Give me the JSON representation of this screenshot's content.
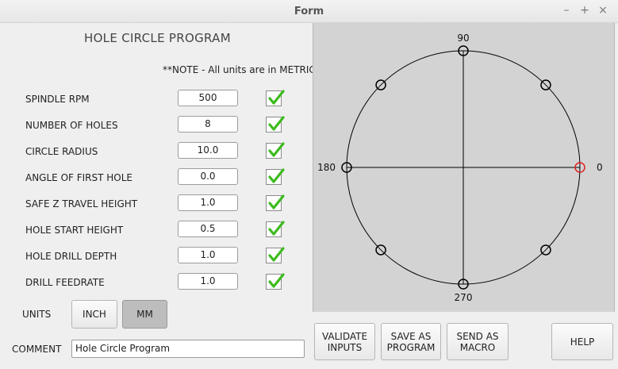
{
  "window": {
    "title": "Form",
    "controls": [
      "–",
      "+",
      "×"
    ]
  },
  "heading": "HOLE CIRCLE PROGRAM",
  "note": "**NOTE - All units are in METRIC",
  "fields": [
    {
      "label": "SPINDLE RPM",
      "value": "500"
    },
    {
      "label": "NUMBER OF HOLES",
      "value": "8"
    },
    {
      "label": "CIRCLE RADIUS",
      "value": "10.0"
    },
    {
      "label": "ANGLE OF FIRST HOLE",
      "value": "0.0"
    },
    {
      "label": "SAFE Z TRAVEL HEIGHT",
      "value": "1.0"
    },
    {
      "label": "HOLE START HEIGHT",
      "value": "0.5"
    },
    {
      "label": "HOLE DRILL DEPTH",
      "value": "1.0"
    },
    {
      "label": "DRILL FEEDRATE",
      "value": "1.0"
    }
  ],
  "checkmark_color": "#3dbb1e",
  "units": {
    "label": "UNITS",
    "inch": "INCH",
    "mm": "MM",
    "selected": "MM"
  },
  "comment": {
    "label": "COMMENT",
    "value": "Hole Circle Program"
  },
  "buttons": {
    "validate": "VALIDATE INPUTS",
    "save": "SAVE AS PROGRAM",
    "send": "SEND AS MACRO",
    "help": "HELP"
  },
  "preview": {
    "labels": {
      "top": "90",
      "left": "180",
      "right": "0",
      "bottom": "270"
    },
    "hole_count": 8,
    "first_hole_angle": 0,
    "first_hole_color": "#e02020",
    "hole_color": "#000000"
  }
}
